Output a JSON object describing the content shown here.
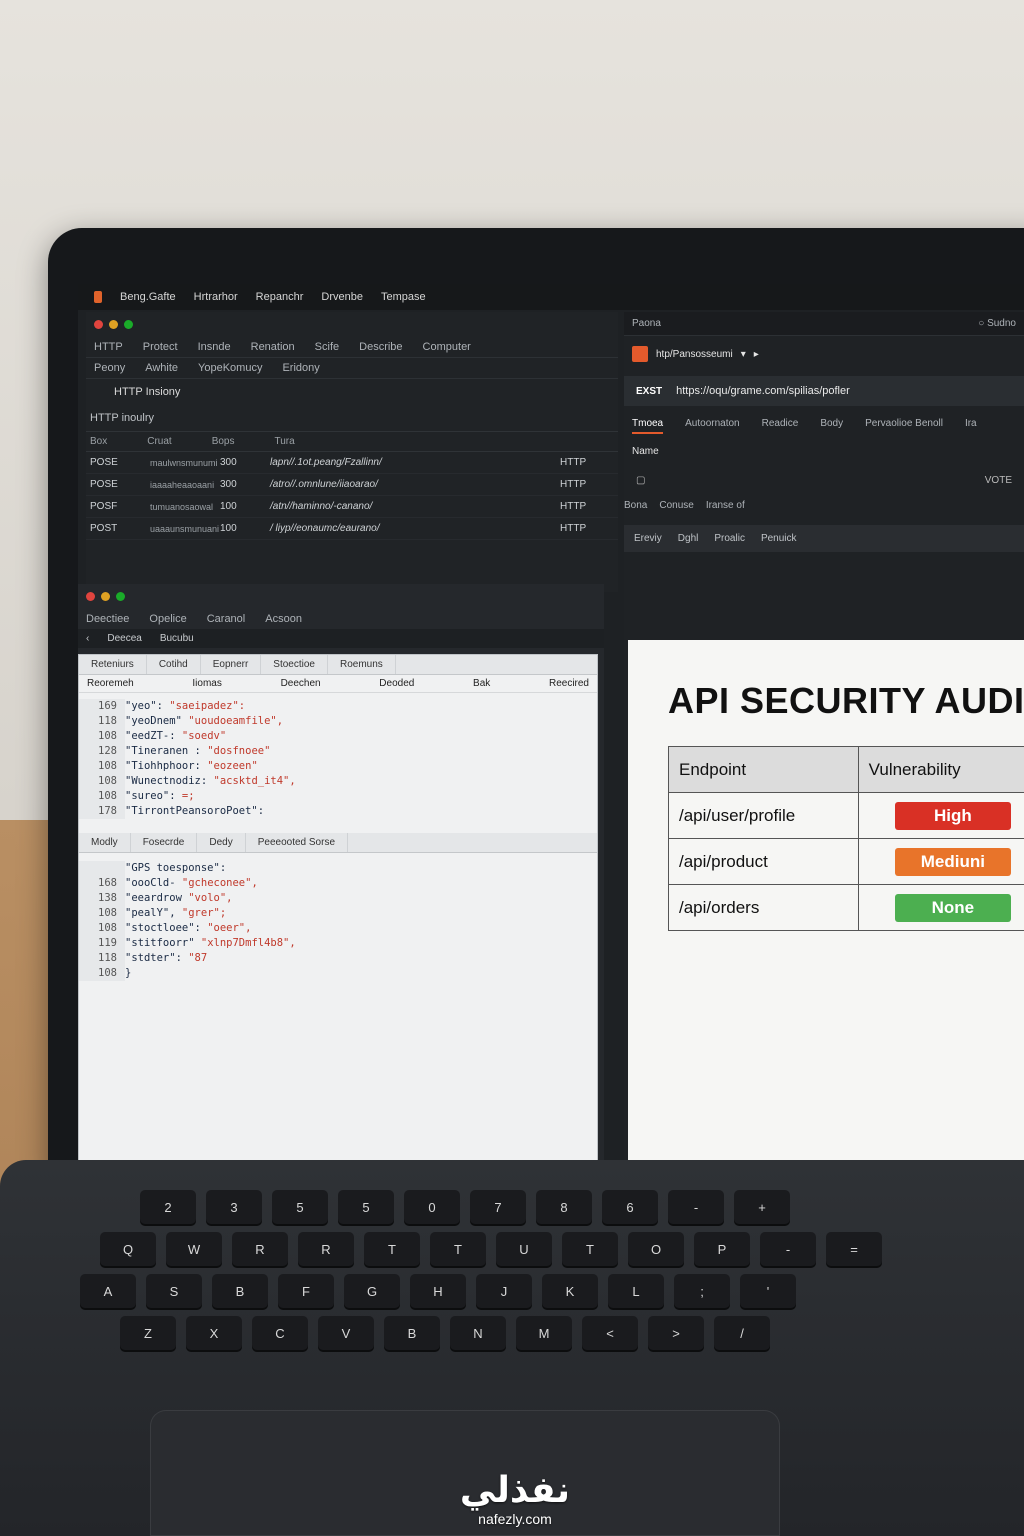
{
  "menubar": [
    "Beng.Gafte",
    "Hrtrarhor",
    "Repanchr",
    "Drvenbe",
    "Tempase"
  ],
  "left": {
    "top_tabs": [
      "HTTP",
      "Protect",
      "Insnde",
      "Renation",
      "Scife",
      "Describe",
      "Computer"
    ],
    "sub_tabs": [
      "Peony",
      "Awhite",
      "YopeKomucy",
      "Eridony"
    ],
    "section_title": "HTTP Insiony",
    "hist_title": "HTTP inoulry",
    "hist_headers": [
      "Box",
      "Cruat",
      "Bops",
      "Tura"
    ],
    "rows": [
      {
        "method": "POSE",
        "id": "maulwnsmunumi",
        "status": "300",
        "path": "lapn//.1ot.peang/Fzallinn/",
        "proto": "HTTP"
      },
      {
        "method": "POSE",
        "id": "iaaaaheaaoaani",
        "status": "300",
        "path": "/atro//.omnlune/iiaoarao/",
        "proto": "HTTP"
      },
      {
        "method": "POSF",
        "id": "tumuanosaowal",
        "status": "100",
        "path": "/atn//haminno/-canano/",
        "proto": "HTTP"
      },
      {
        "method": "POST",
        "id": "uaaaunsmunuani",
        "status": "100",
        "path": "/ liyp//eonaumc/eaurano/",
        "proto": "HTTP"
      }
    ]
  },
  "lower": {
    "tabs": [
      "Deectiee",
      "Opelice",
      "Caranol",
      "Acsoon"
    ],
    "sub": [
      "Deecea",
      "Bucubu"
    ],
    "panel_tabs": [
      "Reteniurs",
      "Cotihd",
      "Eopnerr",
      "Stoectioe",
      "Roemuns"
    ],
    "panel_info": [
      "Reoremeh",
      "Iiomas",
      "Deechen",
      "Deoded",
      "Bak",
      "Reecired"
    ],
    "request_lines": [
      {
        "n": "169",
        "k": "\"yeo\":",
        "v": "\"saeipadez\":"
      },
      {
        "n": "118",
        "k": "\"yeoDnem\"",
        "v": "\"uoudoeamfile\","
      },
      {
        "n": "108",
        "k": "\"eedZT-:",
        "v": "\"soedv\""
      },
      {
        "n": "128",
        "k": "\"Tineranen :",
        "v": "\"dosfnoee\""
      },
      {
        "n": "108",
        "k": "\"Tiohhphoor:",
        "v": "\"eozeen\""
      },
      {
        "n": "108",
        "k": "\"Wunectnodiz:",
        "v": "\"acsktd_it4\","
      },
      {
        "n": "108",
        "k": "\"sureo\":",
        "v": "=;"
      },
      {
        "n": "178",
        "k": "\"TirrontPeansoroPoet\":",
        "v": ""
      }
    ],
    "resp_tabs": [
      "Modly",
      "Fosecrde",
      "Dedy",
      "Peeeooted Sorse"
    ],
    "resp_header": "\"GPS toesponse\":",
    "response_lines": [
      {
        "n": "168",
        "k": "\"oooCld-",
        "v": "\"gcheconee\","
      },
      {
        "n": "138",
        "k": "\"eeardrow",
        "v": "\"volo\","
      },
      {
        "n": "108",
        "k": "\"pealY\",",
        "v": "\"grer\";"
      },
      {
        "n": "108",
        "k": "\"stoctloee\":",
        "v": "\"oeer\","
      },
      {
        "n": "119",
        "k": "\"stitfoorr\"",
        "v": "\"xlnp7Dmfl4b8\","
      },
      {
        "n": "118",
        "k": "\"stdter\":",
        "v": "\"87"
      },
      {
        "n": "108",
        "k": "}",
        "v": ""
      }
    ]
  },
  "right": {
    "top_left": "Paona",
    "search": "Sudno",
    "req_name": "htp/Pansosseumi",
    "method": "EXST",
    "url": "https://oqu/grame.com/spilias/pofler",
    "tabs": [
      "Tmoea",
      "Autoornaton",
      "Readice",
      "Body",
      "Pervaolioe Benoll",
      "Ira"
    ],
    "name_label": "Name",
    "vote": "VOTE",
    "resp_tabs": [
      "Bona",
      "Conuse",
      "Iranse of"
    ],
    "bar": [
      "Ereviy",
      "Dghl",
      "Proalic",
      "Penuick"
    ]
  },
  "audit": {
    "title": "API SECURITY AUDI",
    "headers": [
      "Endpoint",
      "Vulnerability"
    ],
    "rows": [
      {
        "endpoint": "/api/user/profile",
        "level": "High",
        "color": "#d93025"
      },
      {
        "endpoint": "/api/product",
        "level": "Mediuni",
        "color": "#e8742a"
      },
      {
        "endpoint": "/api/orders",
        "level": "None",
        "color": "#4caf50"
      }
    ]
  },
  "keyboard": {
    "row1": [
      "2",
      "3",
      "5",
      "5",
      "0",
      "7",
      "8",
      "6",
      "-",
      "+"
    ],
    "row2": [
      "Q",
      "W",
      "R",
      "R",
      "T",
      "T",
      "U",
      "T",
      "O",
      "P",
      "-",
      "="
    ],
    "row3": [
      "A",
      "S",
      "B",
      "F",
      "G",
      "H",
      "J",
      "K",
      "L",
      ";",
      "'"
    ],
    "row4": [
      "Z",
      "X",
      "C",
      "V",
      "B",
      "N",
      "M",
      "<",
      ">",
      "/"
    ]
  },
  "watermark": {
    "arabic": "نفذلي",
    "latin": "nafezly.com"
  }
}
